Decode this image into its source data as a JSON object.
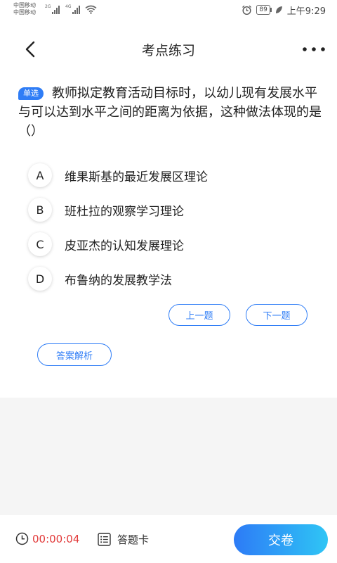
{
  "status_bar": {
    "carrier1": "中国移动",
    "carrier2": "中国移动",
    "net1": "2G",
    "net2": "4G",
    "battery": "89",
    "time": "上午9:29"
  },
  "header": {
    "title": "考点练习"
  },
  "question": {
    "type_badge": "单选",
    "text": "教师拟定教育活动目标时，以幼儿现有发展水平与可以达到水平之间的距离为依据，这种做法体现的是（）"
  },
  "options": [
    {
      "letter": "A",
      "text": "维果斯基的最近发展区理论"
    },
    {
      "letter": "B",
      "text": "班杜拉的观察学习理论"
    },
    {
      "letter": "C",
      "text": "皮亚杰的认知发展理论"
    },
    {
      "letter": "D",
      "text": "布鲁纳的发展教学法"
    }
  ],
  "nav": {
    "prev_label": "上一题",
    "next_label": "下一题",
    "analysis_label": "答案解析"
  },
  "bottom_bar": {
    "timer": "00:00:04",
    "answer_card_label": "答题卡",
    "submit_label": "交卷"
  },
  "colors": {
    "accent": "#2f7df6",
    "timer": "#e23b3b",
    "submit_gradient_start": "#2d7bf6",
    "submit_gradient_end": "#2fc5f5"
  },
  "icons": {
    "back": "chevron-left-icon",
    "more": "more-dots-icon",
    "timer": "clock-icon",
    "answer_card": "list-icon",
    "wifi": "wifi-icon",
    "alarm": "alarm-icon",
    "battery": "battery-icon",
    "leaf": "leaf-icon"
  }
}
